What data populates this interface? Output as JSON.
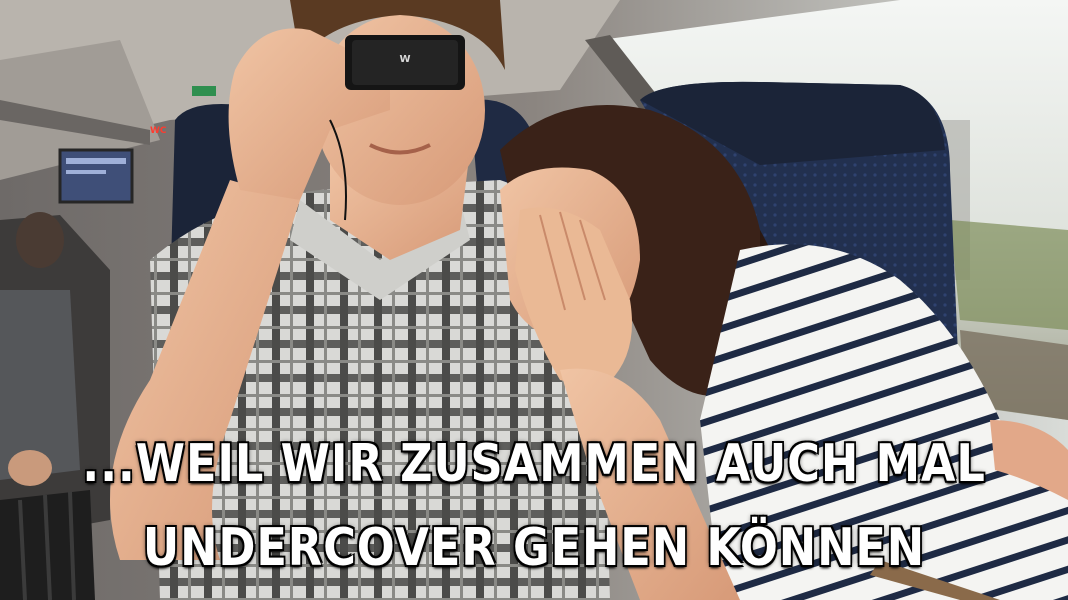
{
  "caption": {
    "line1": "...WEIL WIR ZUSAMMEN AUCH MAL",
    "line2": "UNDERCOVER GEHEN KÖNNEN"
  },
  "signs": {
    "wc": "WC"
  },
  "colors": {
    "train_interior": "#8f8a86",
    "seat_blue": "#1f2d4a",
    "window_light": "#e8ecec",
    "caption_text": "#ffffff"
  }
}
